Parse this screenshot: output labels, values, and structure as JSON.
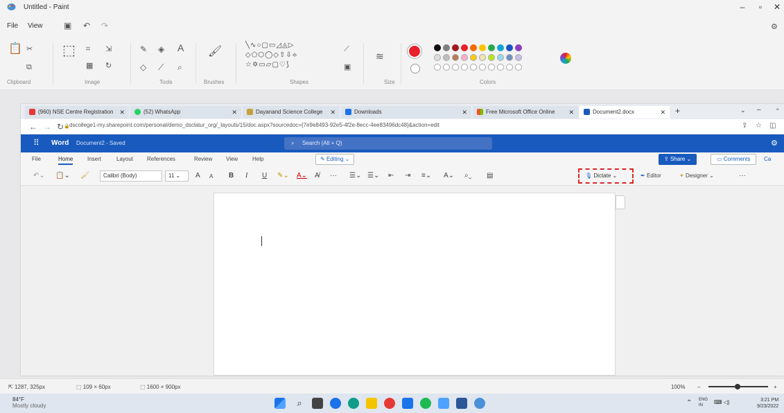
{
  "paint": {
    "title": "Untitled - Paint",
    "menu": [
      "File",
      "View"
    ],
    "ribbon_groups": [
      "Clipboard",
      "Image",
      "Tools",
      "Brushes",
      "Shapes",
      "Size",
      "Colors"
    ],
    "tools_text_glyph": "A",
    "palette_row1": [
      "#111111",
      "#7f7f7f",
      "#9e1b1b",
      "#e8202a",
      "#f56a00",
      "#f9c500",
      "#2ba84a",
      "#12a3d8",
      "#1a55c7",
      "#8b3fbf"
    ],
    "primary_color": "#e8202a",
    "status": {
      "cursor": "1287, 325px",
      "selection": "109 × 60px",
      "canvas": "1600 × 900px",
      "zoom": "100%"
    }
  },
  "browser": {
    "tabs": [
      {
        "title": "(960) NSE Centre Registration",
        "color": "#e53935"
      },
      {
        "title": "(52) WhatsApp",
        "color": "#25d366"
      },
      {
        "title": "Dayanand Science College",
        "color": "#c8a040"
      },
      {
        "title": "Downloads",
        "color": "#1a73e8"
      },
      {
        "title": "Free Microsoft Office Online",
        "color": "#f25022"
      },
      {
        "title": "Document2.docx",
        "color": "#185abd"
      }
    ],
    "new_tab": "+",
    "url": "dscollege1-my.sharepoint.com/personal/demo_dsclatur_org/_layouts/15/doc.aspx?sourcedoc={7e9e8493-92e5-4f2e-8ecc-4ee83496dc48}&action=edit"
  },
  "word": {
    "app_name": "Word",
    "doc_title": "Document2 - Saved",
    "search_placeholder": "Search (Alt + Q)",
    "tabs": [
      "File",
      "Home",
      "Insert",
      "Layout",
      "References",
      "Review",
      "View",
      "Help"
    ],
    "editing_label": "Editing",
    "share_label": "Share",
    "comments_label": "Comments",
    "catchup_label": "Ca",
    "font_name": "Calibri (Body)",
    "font_size": "11",
    "toolbar": {
      "grow": "A",
      "shrink": "A",
      "bold": "B",
      "italic": "I",
      "underline": "U",
      "more": "···",
      "dictate": "Dictate",
      "editor": "Editor",
      "designer": "Designer",
      "overflow": "···"
    }
  },
  "taskbar": {
    "weather_temp": "84°F",
    "weather_desc": "Mostly cloudy",
    "lang_top": "ENG",
    "lang_bottom": "IN",
    "time": "3:21 PM",
    "date": "9/23/2022"
  }
}
